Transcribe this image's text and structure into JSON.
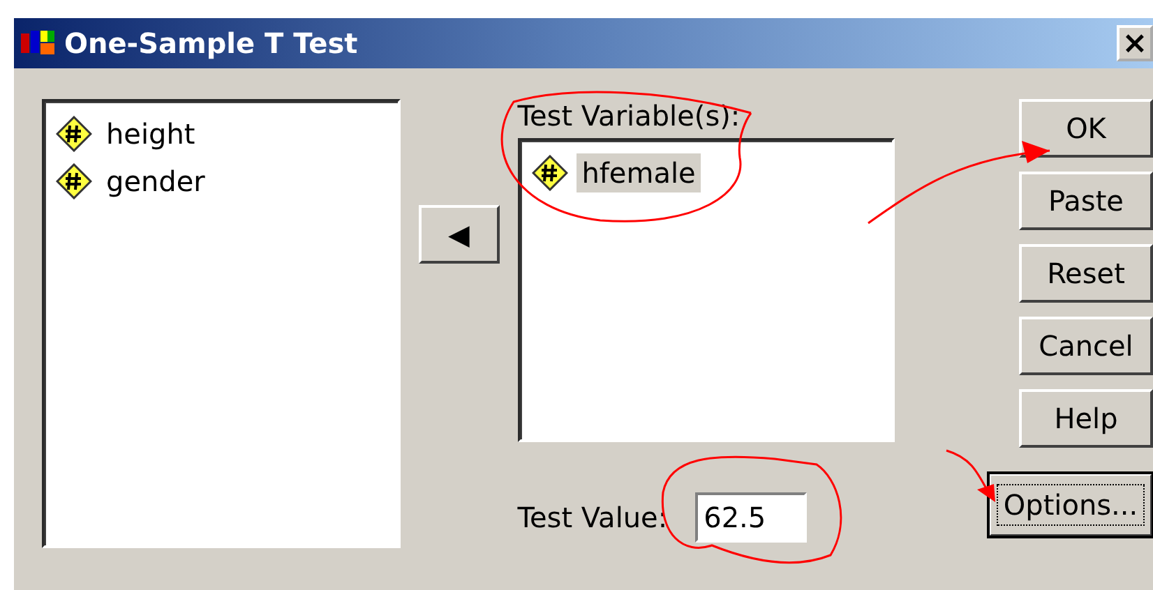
{
  "window": {
    "title": "One-Sample T Test",
    "close": "×"
  },
  "source_list": {
    "items": [
      {
        "label": "height",
        "selected": false
      },
      {
        "label": "gender",
        "selected": false
      }
    ]
  },
  "move_button": {
    "label": "◀"
  },
  "test_variables": {
    "label": "Test Variable(s):",
    "items": [
      {
        "label": "hfemale",
        "selected": true
      }
    ]
  },
  "test_value": {
    "label": "Test Value:",
    "value": "62.5"
  },
  "buttons": [
    {
      "label": "OK",
      "default": false
    },
    {
      "label": "Paste",
      "default": false
    },
    {
      "label": "Reset",
      "default": false
    },
    {
      "label": "Cancel",
      "default": false
    },
    {
      "label": "Help",
      "default": false
    },
    {
      "label": "Options...",
      "default": true
    }
  ]
}
